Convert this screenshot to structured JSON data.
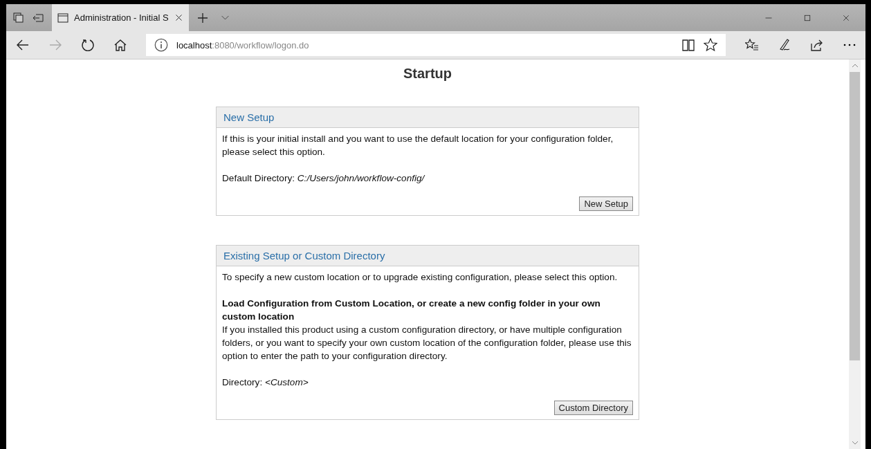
{
  "browser": {
    "tab_title": "Administration - Initial S",
    "address": {
      "host": "localhost",
      "path": ":8080/workflow/logon.do"
    }
  },
  "page": {
    "heading": "Startup",
    "panels": [
      {
        "title": "New Setup",
        "paragraphs": [
          {
            "kind": "text",
            "text": "If this is your initial install and you want to use the default location for your configuration folder, please select this option."
          },
          {
            "kind": "text",
            "text": "Default Directory: *C:/Users/john/workflow-config/*"
          }
        ],
        "button": "New Setup"
      },
      {
        "title": "Existing Setup or Custom Directory",
        "paragraphs": [
          {
            "kind": "text",
            "text": "To specify a new custom location or to upgrade existing configuration, please select this option."
          },
          {
            "kind": "heading",
            "text": "Load Configuration from Custom Location, or create a new config folder in your own custom location"
          },
          {
            "kind": "body",
            "text": "If you installed this product using a custom configuration directory, or have multiple configuration folders, or you want to specify your own custom location of the configuration folder, please use this option to enter the path to your configuration directory."
          },
          {
            "kind": "text",
            "text": "Directory: *<Custom>*"
          }
        ],
        "button": "Custom Directory"
      }
    ]
  }
}
